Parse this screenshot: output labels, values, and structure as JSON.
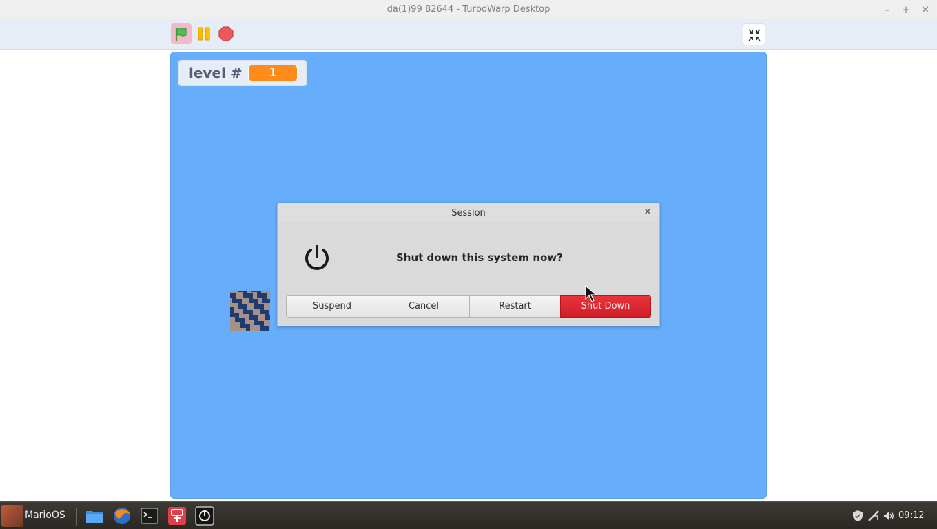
{
  "window": {
    "title": "da(1)99 82644 - TurboWarp Desktop",
    "controls": [
      "minimize-icon",
      "maximize-icon",
      "close-icon"
    ]
  },
  "toolbar": {
    "icons": [
      "green-flag-icon",
      "pause-icon",
      "stop-icon",
      "exit-fullscreen-icon"
    ]
  },
  "stage": {
    "background_color": "#66adfb",
    "monitor": {
      "label": "level #",
      "value": "1"
    }
  },
  "dialog": {
    "title": "Session",
    "message": "Shut down this system now?",
    "buttons": {
      "suspend": "Suspend",
      "cancel": "Cancel",
      "restart": "Restart",
      "shutdown": "Shut Down"
    },
    "accent_color": "#d9252e"
  },
  "taskbar": {
    "start_label": "MarioOS",
    "apps": [
      "folder-icon",
      "browser-icon",
      "terminal-icon",
      "turbowarp-icon",
      "session-icon"
    ],
    "tray": [
      "shield-icon",
      "network-icon",
      "volume-icon"
    ],
    "clock": "09:12"
  }
}
